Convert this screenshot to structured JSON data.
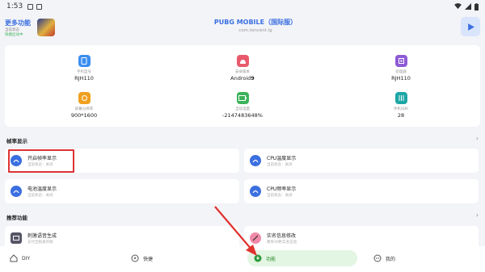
{
  "status": {
    "time": "1:53"
  },
  "header": {
    "more_title": "更多功能",
    "more_sub1": "当前状态",
    "more_sub2": "快捷启动中",
    "game_name": "PUBG MOBILE（国际服）",
    "game_package": "com.tencent.ig"
  },
  "device_info": [
    {
      "label": "手机型号",
      "value": "RJH110",
      "icon": "phone-icon",
      "color": "#3b8ef0"
    },
    {
      "label": "安卓版本",
      "value": "Android",
      "value_bold": "9",
      "icon": "android-icon",
      "color": "#e85a6b"
    },
    {
      "label": "处理器",
      "value": "RJH110",
      "icon": "chip-icon",
      "color": "#8e5bd6"
    },
    {
      "label": "屏幕分辨率",
      "value": "900*1600",
      "icon": "screen-icon",
      "color": "#f0a020"
    },
    {
      "label": "当前电量",
      "value": "-2147483648%",
      "icon": "battery-icon",
      "color": "#3cb35a"
    },
    {
      "label": "手机SDK",
      "value": "28",
      "icon": "sdk-icon",
      "color": "#1ea6a6"
    }
  ],
  "sections": {
    "frame": "帧率显示",
    "recommend": "推荐功能"
  },
  "frame_features": [
    {
      "title": "开启帧率显示",
      "sub": "当前状态：关闭"
    },
    {
      "title": "CPU温度显示",
      "sub": "当前状态：关闭"
    },
    {
      "title": "电池温度显示",
      "sub": "当前状态：关闭"
    },
    {
      "title": "CPU频率显示",
      "sub": "当前状态：关闭"
    }
  ],
  "recommend_features": [
    {
      "title": "刺激语音生成",
      "sub": "支付宝极速开始"
    },
    {
      "title": "实名信息修改",
      "sub": "教你30秒实名信息"
    }
  ],
  "nav": {
    "diy": "DIY",
    "shortcut": "快捷",
    "function": "功能",
    "mine": "我的"
  },
  "colors": {
    "accent": "#3b6fe0",
    "active_nav_bg": "#e3f5e3",
    "highlight": "#dd3333"
  }
}
